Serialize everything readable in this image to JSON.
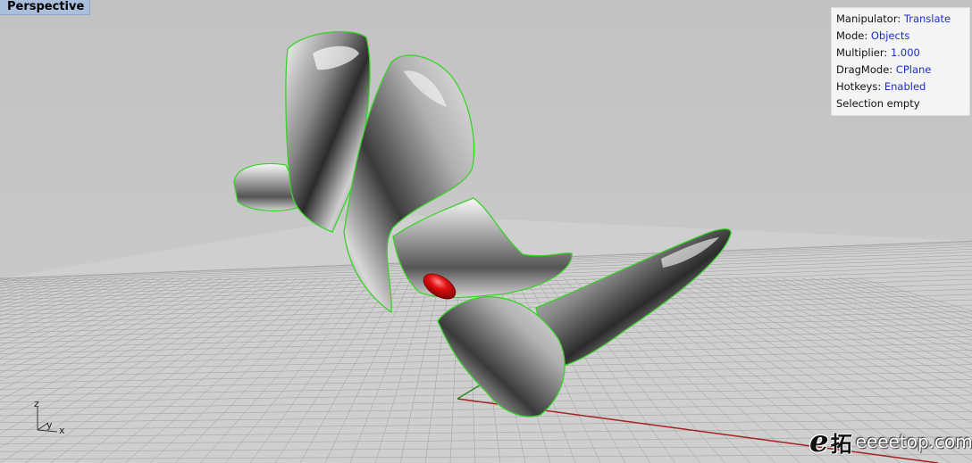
{
  "viewport": {
    "title": "Perspective"
  },
  "hud": {
    "rows": [
      {
        "label": "Manipulator:",
        "value": "Translate"
      },
      {
        "label": "Mode:",
        "value": "Objects"
      },
      {
        "label": "Multiplier:",
        "value": "1.000"
      },
      {
        "label": "DragMode:",
        "value": "CPlane"
      },
      {
        "label": "Hotkeys:",
        "value": "Enabled"
      },
      {
        "label": "Selection empty",
        "value": ""
      }
    ]
  },
  "axis_indicator": {
    "z": "z",
    "y": "y",
    "x": "x"
  },
  "watermark": {
    "logo": "e",
    "cjk": "拓",
    "site": "eeeetop.com"
  },
  "colors": {
    "selection_outline": "#3ad12a",
    "x_axis": "#a82020",
    "y_axis": "#2a8a2a",
    "hud_value": "#1d2fc4",
    "viewport_tab": "#a9bfdc"
  }
}
